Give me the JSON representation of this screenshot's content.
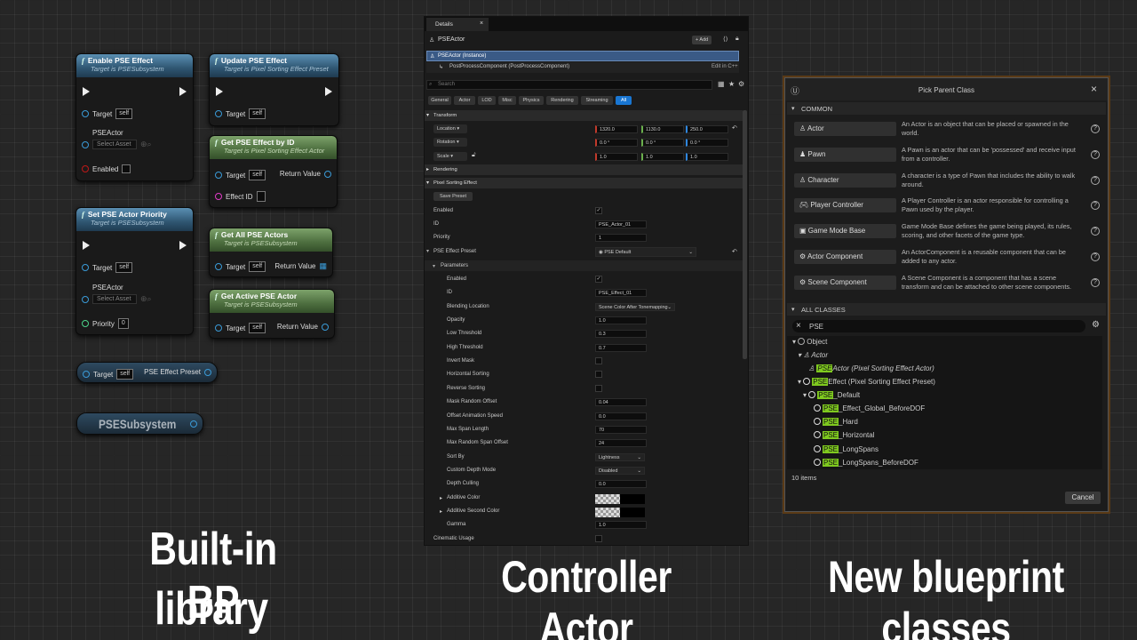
{
  "bp_library": {
    "nodes": {
      "enable": {
        "title": "Enable PSE Effect",
        "subtitle": "Target is PSESubsystem",
        "target_label": "Target",
        "self": "self",
        "actor_label": "PSEActor",
        "select_asset": "Select Asset",
        "enabled_label": "Enabled"
      },
      "update": {
        "title": "Update PSE Effect",
        "subtitle": "Target is Pixel Sorting Effect Preset",
        "target_label": "Target",
        "self": "self"
      },
      "getbyid": {
        "title": "Get PSE Effect by ID",
        "subtitle": "Target is Pixel Sorting Effect Actor",
        "target_label": "Target",
        "self": "self",
        "return_label": "Return Value",
        "effect_id_label": "Effect ID"
      },
      "setprio": {
        "title": "Set PSE Actor Priority",
        "subtitle": "Target is PSESubsystem",
        "target_label": "Target",
        "self": "self",
        "actor_label": "PSEActor",
        "select_asset": "Select Asset",
        "priority_label": "Priority",
        "priority_value": "0"
      },
      "getall": {
        "title": "Get All PSE Actors",
        "subtitle": "Target is PSESubsystem",
        "target_label": "Target",
        "self": "self",
        "return_label": "Return Value"
      },
      "getactive": {
        "title": "Get Active PSE Actor",
        "subtitle": "Target is PSESubsystem",
        "target_label": "Target",
        "self": "self",
        "return_label": "Return Value"
      },
      "getpreset": {
        "target_label": "Target",
        "self": "self",
        "return_label": "PSE Effect Preset"
      },
      "subsystem": {
        "label": "PSESubsystem"
      }
    },
    "fx_glyph": "f"
  },
  "captions": {
    "left_line1": "Built-in BP",
    "left_line2": "library",
    "middle": "Controller Actor",
    "right": "New blueprint classes"
  },
  "details": {
    "tab_label": "Details",
    "actor_name": "PSEActor",
    "add_label": "+ Add",
    "instance_label": "PSEActor (Instance)",
    "component_label": "PostProcessComponent (PostProcessComponent)",
    "edit_cpp": "Edit in C++",
    "search_placeholder": "Search",
    "filter_tabs": [
      "General",
      "Actor",
      "LOD",
      "Misc",
      "Physics",
      "Rendering",
      "Streaming",
      "All"
    ],
    "transform": {
      "section": "Transform",
      "location": "Location",
      "rotation": "Rotation",
      "scale": "Scale",
      "loc": [
        "1320.0",
        "1130.0",
        "250.0"
      ],
      "rot": [
        "0.0 °",
        "0.0 °",
        "0.0 °"
      ],
      "scl": [
        "1.0",
        "1.0",
        "1.0"
      ]
    },
    "rendering_section": "Rendering",
    "pse_section": "Pixel Sorting Effect",
    "save_preset": "Save Preset",
    "props": {
      "enabled": "Enabled",
      "id": "ID",
      "id_value": "PSE_Actor_01",
      "priority": "Priority",
      "priority_value": "1",
      "preset": "PSE Effect Preset",
      "preset_value": "PSE Default"
    },
    "parameters_section": "Parameters",
    "params": [
      {
        "label": "Enabled",
        "type": "check",
        "value": "✓"
      },
      {
        "label": "ID",
        "type": "text",
        "value": "PSE_Effect_01"
      },
      {
        "label": "Blending Location",
        "type": "combo",
        "value": "Scene Color After Tonemapping"
      },
      {
        "label": "Opacity",
        "type": "num",
        "value": "1.0"
      },
      {
        "label": "Low Threshold",
        "type": "num",
        "value": "0.3"
      },
      {
        "label": "High Threshold",
        "type": "num",
        "value": "0.7"
      },
      {
        "label": "Invert Mask",
        "type": "check",
        "value": ""
      },
      {
        "label": "Horizontal Sorting",
        "type": "check",
        "value": ""
      },
      {
        "label": "Reverse Sorting",
        "type": "check",
        "value": ""
      },
      {
        "label": "Mask Random Offset",
        "type": "num",
        "value": "0.04"
      },
      {
        "label": "Offset Animation Speed",
        "type": "num",
        "value": "0.0"
      },
      {
        "label": "Max Span Length",
        "type": "num",
        "value": "70"
      },
      {
        "label": "Max Random Span Offset",
        "type": "num",
        "value": "24"
      },
      {
        "label": "Sort By",
        "type": "combo",
        "value": "Lightness"
      },
      {
        "label": "Custom Depth Mode",
        "type": "combo",
        "value": "Disabled"
      },
      {
        "label": "Depth Culling",
        "type": "num",
        "value": "0.0"
      },
      {
        "label": "Additive Color",
        "type": "color",
        "value": ""
      },
      {
        "label": "Additive Second Color",
        "type": "color",
        "value": ""
      },
      {
        "label": "Gamma",
        "type": "num",
        "value": "1.0"
      }
    ],
    "cinematic_usage": "Cinematic Usage"
  },
  "picker": {
    "title": "Pick Parent Class",
    "common_label": "COMMON",
    "common": [
      {
        "name": "Actor",
        "desc": "An Actor is an object that can be placed or spawned in the world."
      },
      {
        "name": "Pawn",
        "desc": "A Pawn is an actor that can be 'possessed' and receive input from a controller."
      },
      {
        "name": "Character",
        "desc": "A character is a type of Pawn that includes the ability to walk around."
      },
      {
        "name": "Player Controller",
        "desc": "A Player Controller is an actor responsible for controlling a Pawn used by the player."
      },
      {
        "name": "Game Mode Base",
        "desc": "Game Mode Base defines the game being played, its rules, scoring, and other facets of the game type."
      },
      {
        "name": "Actor Component",
        "desc": "An ActorComponent is a reusable component that can be added to any actor."
      },
      {
        "name": "Scene Component",
        "desc": "A Scene Component is a component that has a scene transform and can be attached to other scene components."
      }
    ],
    "all_label": "ALL CLASSES",
    "search_value": "PSE",
    "tree": {
      "object": "Object",
      "actor": "Actor",
      "pseactor_hl": "PSE",
      "pseactor_rest": "Actor (Pixel Sorting Effect Actor)",
      "pseeffect_hl": "PSE",
      "pseeffect_rest": "Effect (Pixel Sorting Effect Preset)",
      "default_hl": "PSE",
      "default_rest": "_Default",
      "children": [
        {
          "hl": "PSE",
          "rest": "_Effect_Global_BeforeDOF"
        },
        {
          "hl": "PSE",
          "rest": "_Hard"
        },
        {
          "hl": "PSE",
          "rest": "_Horizontal"
        },
        {
          "hl": "PSE",
          "rest": "_LongSpans"
        },
        {
          "hl": "PSE",
          "rest": "_LongSpans_BeforeDOF"
        }
      ]
    },
    "count": "10 items",
    "cancel": "Cancel"
  }
}
